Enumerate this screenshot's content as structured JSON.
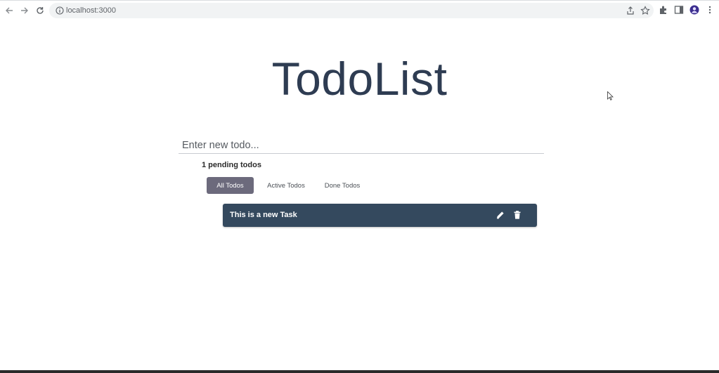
{
  "browser": {
    "url": "localhost:3000",
    "icons": [
      "back-icon",
      "forward-icon",
      "reload-icon",
      "site-info-icon",
      "share-icon",
      "bookmark-star-icon",
      "extensions-icon",
      "side-panel-icon",
      "profile-icon",
      "menu-icon"
    ]
  },
  "app": {
    "title": "TodoList",
    "input_placeholder": "Enter new todo...",
    "pending_text": "1 pending todos",
    "filters": [
      {
        "label": "All Todos",
        "active": true
      },
      {
        "label": "Active Todos",
        "active": false
      },
      {
        "label": "Done Todos",
        "active": false
      }
    ],
    "todos": [
      {
        "text": "This is a new Task",
        "actions": [
          "edit-icon",
          "delete-icon"
        ]
      }
    ]
  },
  "colors": {
    "title": "#2e3c52",
    "active_filter": "#6c6a7c",
    "todo_item_bg": "#34495e",
    "todo_item_text": "#ffffff"
  }
}
